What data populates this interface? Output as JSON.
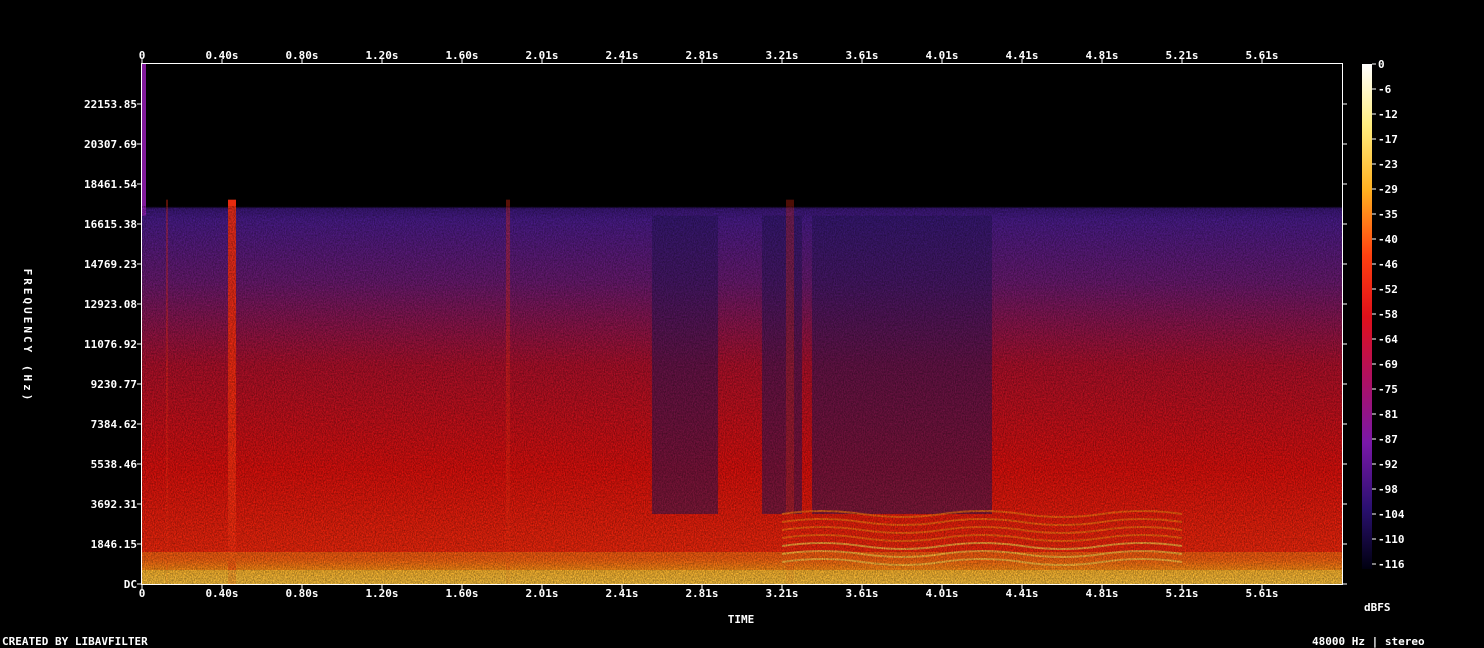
{
  "chart_data": {
    "type": "heatmap",
    "subtype": "spectrogram",
    "colormap": "intensity (black-purple-red-orange-yellow-white)",
    "x_ticks": [
      "0",
      "0.40s",
      "0.80s",
      "1.20s",
      "1.60s",
      "2.01s",
      "2.41s",
      "2.81s",
      "3.21s",
      "3.61s",
      "4.01s",
      "4.41s",
      "4.81s",
      "5.21s",
      "5.61s"
    ],
    "y_ticks": [
      "DC",
      "1846.15",
      "3692.31",
      "5538.46",
      "7384.62",
      "9230.77",
      "11076.92",
      "12923.08",
      "14769.23",
      "16615.38",
      "18461.54",
      "20307.69",
      "22153.85"
    ],
    "colorbar_ticks": [
      "0",
      "-6",
      "-12",
      "-17",
      "-23",
      "-29",
      "-35",
      "-40",
      "-46",
      "-52",
      "-58",
      "-64",
      "-69",
      "-75",
      "-81",
      "-87",
      "-92",
      "-98",
      "-104",
      "-110",
      "-116"
    ],
    "xlabel": "TIME",
    "ylabel": "FREQUENCY (Hz)",
    "colorbar_label": "dBFS",
    "footer_left": "CREATED BY LIBAVFILTER",
    "footer_right": "48000 Hz | stereo",
    "xlim": [
      0,
      6.0
    ],
    "ylim": [
      0,
      24000
    ],
    "zlim": [
      -120,
      0
    ],
    "cutoff_hz": 17000
  }
}
